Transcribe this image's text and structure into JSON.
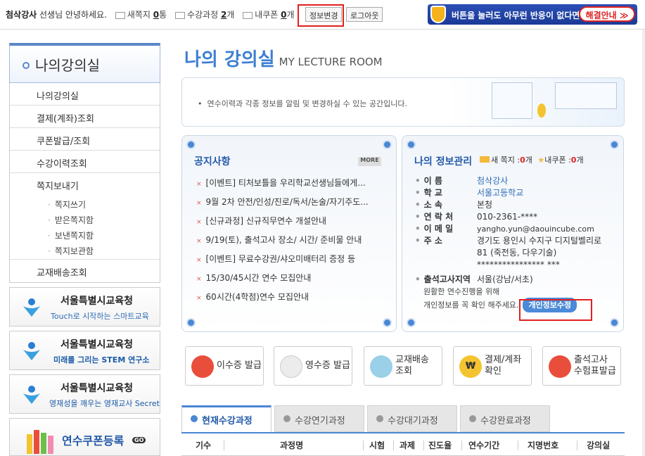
{
  "topbar": {
    "user_name": "첨삭강사",
    "greeting": "선생님 안녕하세요.",
    "new_notes_label": "새쪽지",
    "new_notes_count": "0",
    "new_notes_unit": "통",
    "courses_label": "수강과정",
    "courses_count": "2",
    "courses_unit": "개",
    "coupons_label": "내쿠폰",
    "coupons_count": "0",
    "coupons_unit": "개",
    "edit_info_button": "정보변경",
    "logout_button": "로그아웃",
    "banner_text": "버튼을 눌러도 아무런 반응이 없다면!",
    "help_button": "해결안내 ≫"
  },
  "sidebar": {
    "title": "나의강의실",
    "items": [
      {
        "label": "나의강의실"
      },
      {
        "label": "결제(계좌)조회"
      },
      {
        "label": "쿠폰발급/조회"
      },
      {
        "label": "수강이력조회"
      },
      {
        "label": "쪽지보내기"
      }
    ],
    "sub_items": [
      {
        "label": "쪽지쓰기"
      },
      {
        "label": "받은쪽지함"
      },
      {
        "label": "보낸쪽지함"
      },
      {
        "label": "쪽지보관함"
      }
    ],
    "last_item": "교재배송조회"
  },
  "promos": [
    {
      "title": "서울특별시교육청",
      "subtitle": "Touch로 시작하는 스마트교육"
    },
    {
      "title": "서울특별시교육청",
      "subtitle": "미래를 그리는 STEM 연구소"
    },
    {
      "title": "서울특별시교육청",
      "subtitle": "영재성을 깨우는 영재교사 Secret"
    },
    {
      "title": "연수쿠폰등록",
      "subtitle": "GO"
    }
  ],
  "main": {
    "title": "나의 강의실",
    "title_en": "MY LECTURE ROOM",
    "intro": "연수이력과 각종 정보를 알림 및 변경하실 수 있는 공간입니다."
  },
  "notice": {
    "title": "공지사항",
    "more": "MORE",
    "items": [
      "[이벤트] 티처보틀을 우리학교선생님들에게...",
      "9월 2차 안전/인성/진로/독서/논술/자기주도...",
      "[신규과정] 신규직무연수 개설안내",
      "9/19(토), 출석고사 장소/ 시간/ 준비물 안내",
      "[이벤트] 무료수강권/샤오미배터리 증정 등",
      "15/30/45시간 연수 모집안내",
      "60시간(4학점)연수 모집안내"
    ]
  },
  "myinfo": {
    "title": "나의 정보관리",
    "new_note_label": "새 쪽지 :",
    "new_note_count": "0",
    "new_note_unit": "개",
    "coupon_label": "내쿠폰 :",
    "coupon_count": "0",
    "coupon_unit": "개",
    "rows": [
      {
        "key": "이 름",
        "value": "첨삭강사"
      },
      {
        "key": "학 교",
        "value": "서울고등학교"
      },
      {
        "key": "소 속",
        "value": "본청"
      },
      {
        "key": "연 락 처",
        "value": "010-2361-****"
      },
      {
        "key": "이 메 일",
        "value": "yangho.yun@daouincube.com"
      },
      {
        "key": "주 소",
        "value": "경기도 용인시 수지구 디지털벨리로 81 (죽전동, 다우기술) **************** ***"
      }
    ],
    "exam_area_label": "출석고사지역",
    "exam_area_value": "서울(강남/서초)",
    "note_line1": "원활한 연수진행을 위해",
    "note_line2": "개인정보를 꼭 확인 해주세요.",
    "edit_button": "개인정보수정"
  },
  "quick_buttons": [
    {
      "label": "이수증 발급"
    },
    {
      "label": "영수증 발급"
    },
    {
      "label": "교재배송\n조회"
    },
    {
      "label": "결제/계좌\n확인"
    },
    {
      "label": "출석고사\n수험표발급"
    }
  ],
  "tabs": [
    {
      "label": "현재수강과정"
    },
    {
      "label": "수강연기과정"
    },
    {
      "label": "수강대기과정"
    },
    {
      "label": "수강완료과정"
    }
  ],
  "table_headers": [
    "기수",
    "과정명",
    "시험",
    "과제",
    "진도율",
    "연수기간",
    "지명번호",
    "강의실"
  ],
  "colors": {
    "accent": "#4a86d4",
    "brand_title": "#3d7fd1",
    "highlight": "#e02020"
  }
}
